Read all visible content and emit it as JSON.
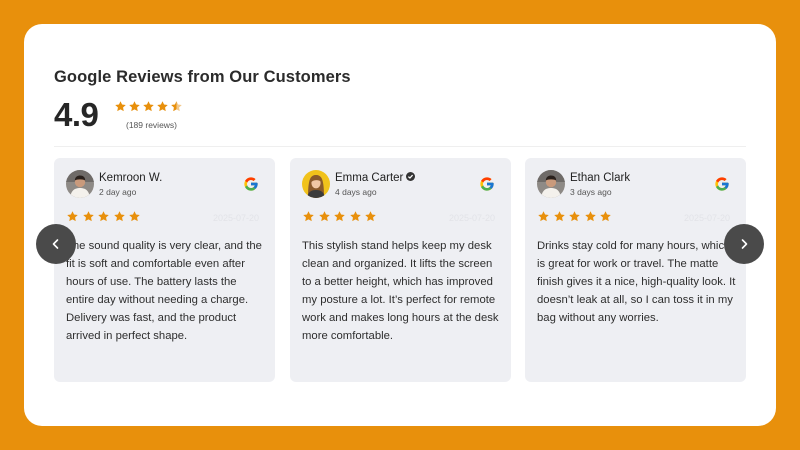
{
  "widget": {
    "heading": "Google Reviews from Our Customers",
    "average_rating": "4.9",
    "average_rating_value": 4.5,
    "review_count": "(189 reviews)",
    "star_color": "#E8900C",
    "accent_background": "#E8900C"
  },
  "navigation": {
    "prev_icon": "chevron-left-icon",
    "next_icon": "chevron-right-icon"
  },
  "reviews": [
    {
      "name": "Kemroon W.",
      "verified": false,
      "time_ago": "2 day ago",
      "date": "2025-07-20",
      "stars": 5,
      "text": "The sound quality is very clear, and the fit is soft and comfortable even after hours of use. The battery lasts the entire day without needing a charge. Delivery was fast, and the product arrived in perfect shape.",
      "source_icon": "google-icon"
    },
    {
      "name": "Emma Carter",
      "verified": true,
      "time_ago": "4 days ago",
      "date": "2025-07-20",
      "stars": 5,
      "text": "This stylish stand helps keep my desk clean and organized. It lifts the screen to a better height, which has improved my posture a lot. It’s perfect for remote work and makes long hours at the desk more comfortable.",
      "source_icon": "google-icon"
    },
    {
      "name": "Ethan Clark",
      "verified": false,
      "time_ago": "3 days ago",
      "date": "2025-07-20",
      "stars": 5,
      "text": "Drinks stay cold for many hours, which is great for work or travel. The matte finish gives it a nice, high-quality look. It doesn’t leak at all, so I can toss it in my bag without any worries.",
      "source_icon": "google-icon"
    }
  ]
}
